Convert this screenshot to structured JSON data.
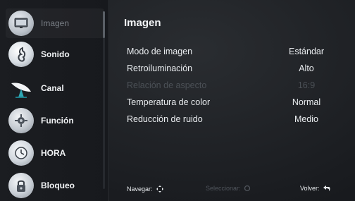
{
  "sidebar": {
    "items": [
      {
        "label": "Imagen",
        "icon": "picture-icon",
        "active": true
      },
      {
        "label": "Sonido",
        "icon": "music-note-icon"
      },
      {
        "label": "Canal",
        "icon": "satellite-dish-icon"
      },
      {
        "label": "Función",
        "icon": "gear-icon"
      },
      {
        "label": "HORA",
        "icon": "clock-icon"
      },
      {
        "label": "Bloqueo",
        "icon": "lock-icon"
      }
    ]
  },
  "main": {
    "title": "Imagen",
    "settings": [
      {
        "label": "Modo de imagen",
        "value": "Estándar"
      },
      {
        "label": "Retroiluminación",
        "value": "Alto"
      },
      {
        "label": "Relación de aspecto",
        "value": "16:9",
        "disabled": true
      },
      {
        "label": "Temperatura de color",
        "value": "Normal"
      },
      {
        "label": "Reducción de ruido",
        "value": "Medio"
      }
    ]
  },
  "footer": {
    "navigate": "Navegar:",
    "select": "Seleccionar:",
    "back": "Volver:"
  }
}
